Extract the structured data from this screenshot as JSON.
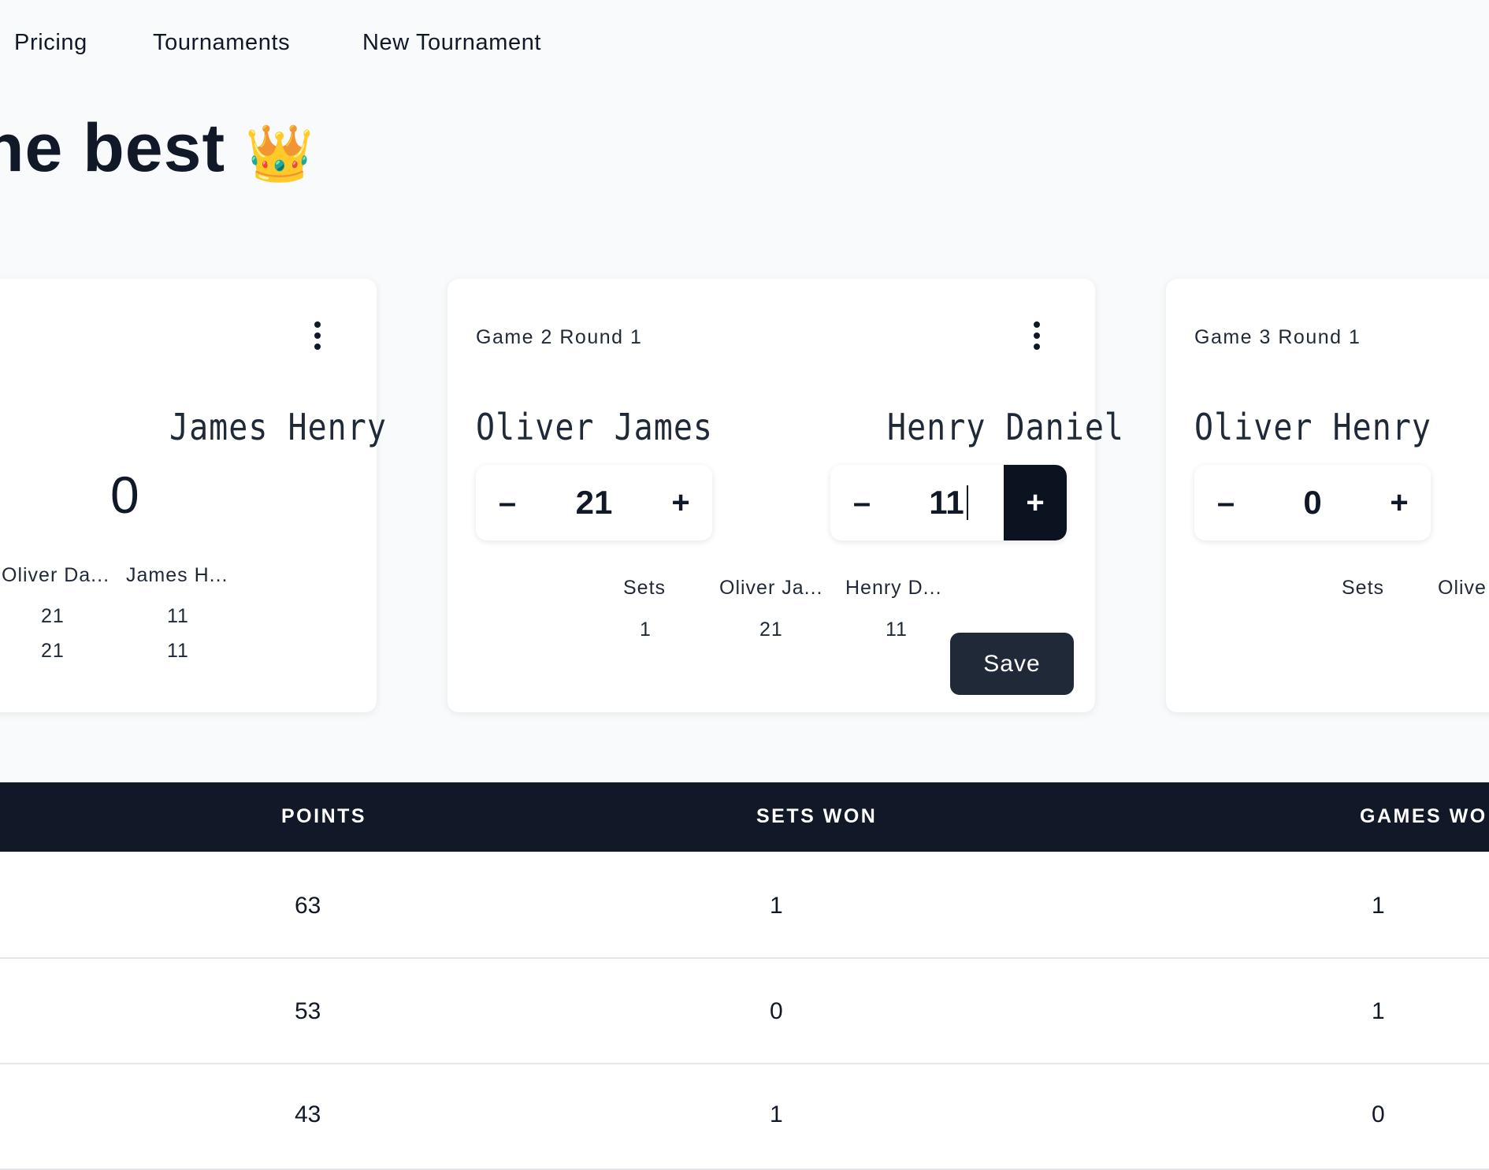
{
  "nav": {
    "items": [
      "Pricing",
      "Tournaments",
      "New Tournament"
    ]
  },
  "hero": {
    "title": "he best",
    "emoji": "👑"
  },
  "cards": [
    {
      "title": "",
      "player_right": "James Henry",
      "score": "0",
      "columns": [
        "Oliver Da...",
        "James H..."
      ],
      "rows": [
        [
          "21",
          "11"
        ],
        [
          "21",
          "11"
        ]
      ]
    },
    {
      "title": "Game 2 Round 1",
      "player_left": "Oliver James",
      "player_right": "Henry Daniel",
      "score_left": "21",
      "score_right": "11",
      "table_headers": [
        "Sets",
        "Oliver Ja...",
        "Henry D..."
      ],
      "table_values": [
        "1",
        "21",
        "11"
      ],
      "save_label": "Save"
    },
    {
      "title": "Game 3 Round 1",
      "player_left": "Oliver Henry",
      "score_left": "0",
      "table_headers": [
        "Sets",
        "Olive"
      ]
    }
  ],
  "stepper": {
    "minus": "–",
    "plus": "+"
  },
  "table": {
    "headers": [
      "POINTS",
      "SETS WON",
      "GAMES WO"
    ],
    "rows": [
      [
        "63",
        "1",
        "1"
      ],
      [
        "53",
        "0",
        "1"
      ],
      [
        "43",
        "1",
        "0"
      ]
    ]
  }
}
